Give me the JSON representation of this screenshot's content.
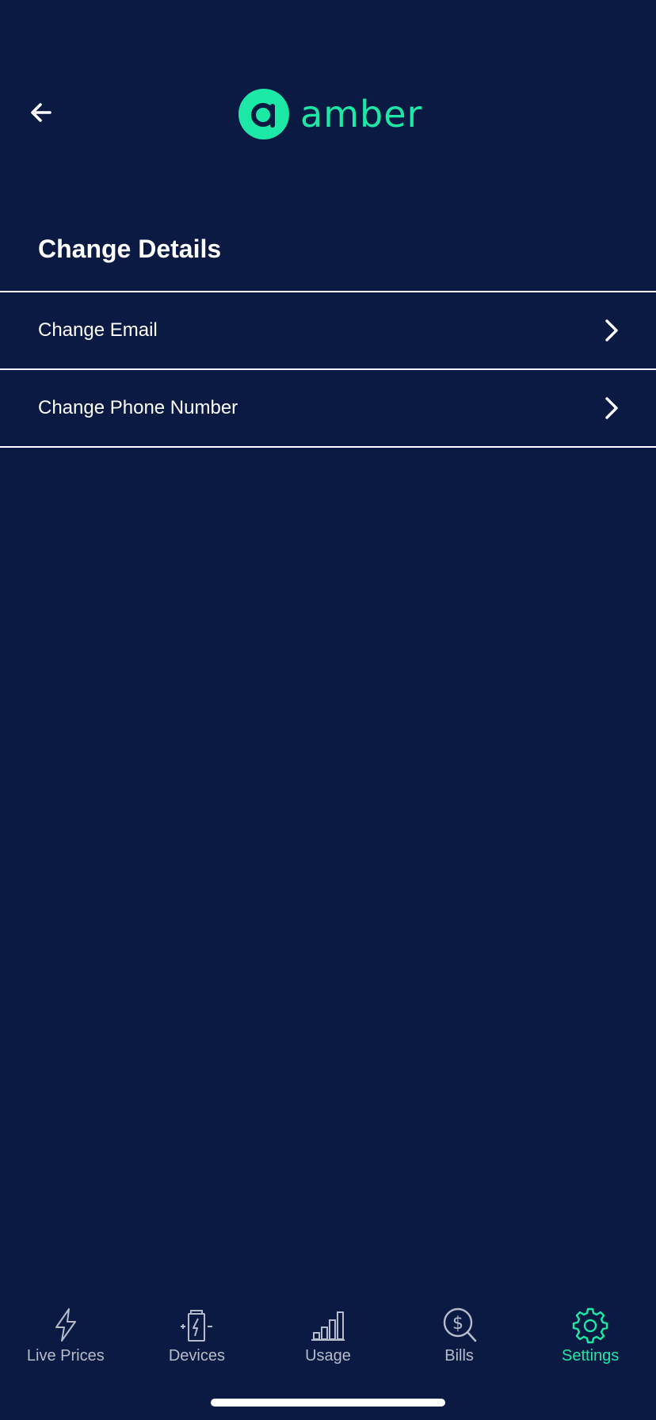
{
  "brand": {
    "name": "amber",
    "accent_color": "#1de9a6",
    "background_color": "#0b1a42"
  },
  "header": {
    "back_icon": "arrow-left-icon",
    "logo_icon": "amber-logo-icon"
  },
  "section": {
    "title": "Change Details"
  },
  "menu": {
    "items": [
      {
        "label": "Change Email",
        "icon": "chevron-right-icon"
      },
      {
        "label": "Change Phone Number",
        "icon": "chevron-right-icon"
      }
    ]
  },
  "tabbar": {
    "tabs": [
      {
        "label": "Live Prices",
        "icon": "lightning-icon",
        "active": false
      },
      {
        "label": "Devices",
        "icon": "battery-icon",
        "active": false
      },
      {
        "label": "Usage",
        "icon": "bar-chart-icon",
        "active": false
      },
      {
        "label": "Bills",
        "icon": "dollar-search-icon",
        "active": false
      },
      {
        "label": "Settings",
        "icon": "gear-icon",
        "active": true
      }
    ]
  }
}
